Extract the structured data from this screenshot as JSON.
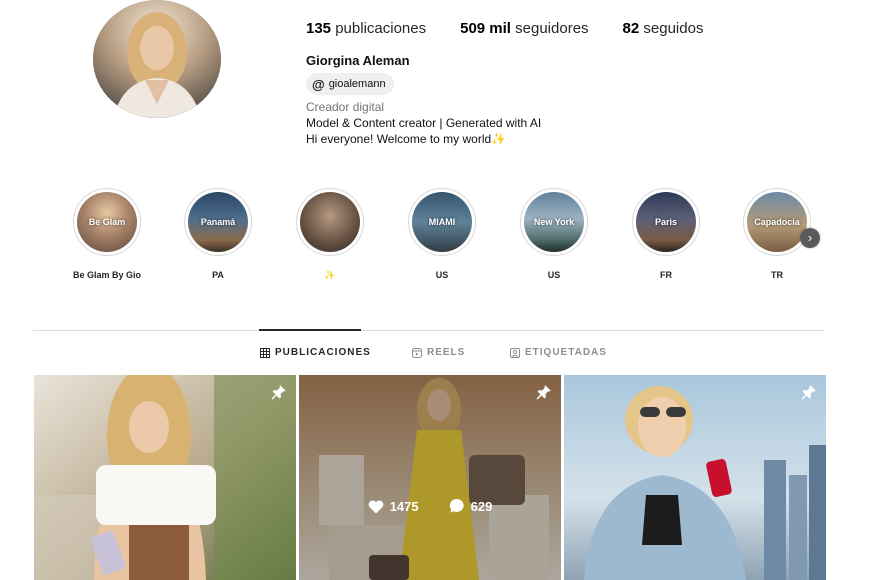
{
  "profile": {
    "posts_count": "135",
    "posts_label": "publicaciones",
    "followers_count": "509 mil",
    "followers_label": "seguidores",
    "following_count": "82",
    "following_label": "seguidos",
    "full_name": "Giorgina Aleman",
    "threads_handle": "gioalemann",
    "category": "Creador digital",
    "bio_line1": "Model & Content creator | Generated with AI",
    "bio_line2": "Hi everyone! Welcome to my world",
    "bio_emoji": "✨"
  },
  "highlights": [
    {
      "cover_text": "Be Glam",
      "label": "Be Glam By Gio"
    },
    {
      "cover_text": "Panamá",
      "label": "PA"
    },
    {
      "cover_text": "",
      "label": "✨"
    },
    {
      "cover_text": "MIAMI",
      "label": "US"
    },
    {
      "cover_text": "New York",
      "label": "US"
    },
    {
      "cover_text": "Paris",
      "label": "FR"
    },
    {
      "cover_text": "Capadocia",
      "label": "TR"
    }
  ],
  "tabs": [
    {
      "label": "PUBLICACIONES",
      "icon": "grid-icon",
      "active": true
    },
    {
      "label": "REELS",
      "icon": "reels-icon",
      "active": false
    },
    {
      "label": "ETIQUETADAS",
      "icon": "tagged-icon",
      "active": false
    }
  ],
  "posts": [
    {
      "pinned": true
    },
    {
      "pinned": true,
      "likes": "1475",
      "comments": "629"
    },
    {
      "pinned": true
    }
  ],
  "colors": {
    "muted_text": "#737373",
    "active_tab": "#262626",
    "inactive_tab": "#8e8e8e"
  }
}
